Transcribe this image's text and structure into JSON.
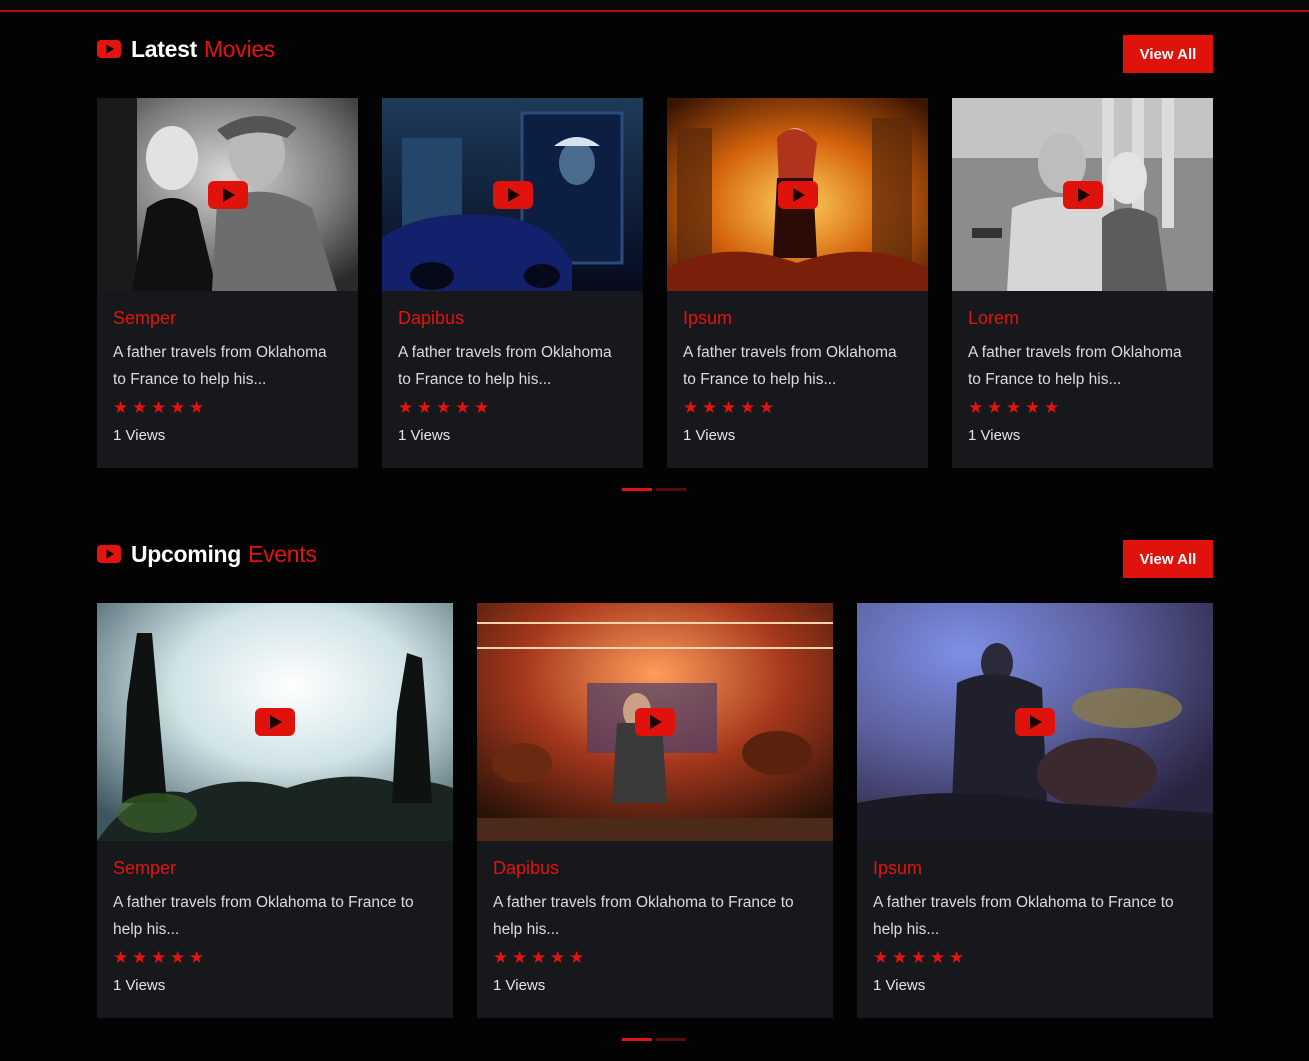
{
  "sections": [
    {
      "title_white": "Latest",
      "title_red": "Movies",
      "view_all_label": "View All",
      "cards": [
        {
          "title": "Semper",
          "description": "A father travels from Oklahoma to France to help his...",
          "rating": 5,
          "views": "1 Views"
        },
        {
          "title": "Dapibus",
          "description": "A father travels from Oklahoma to France to help his...",
          "rating": 5,
          "views": "1 Views"
        },
        {
          "title": "Ipsum",
          "description": "A father travels from Oklahoma to France to help his...",
          "rating": 5,
          "views": "1 Views"
        },
        {
          "title": "Lorem",
          "description": "A father travels from Oklahoma to France to help his...",
          "rating": 5,
          "views": "1 Views"
        }
      ],
      "pager": {
        "pages": 2,
        "active": 0
      }
    },
    {
      "title_white": "Upcoming",
      "title_red": "Events",
      "view_all_label": "View All",
      "cards": [
        {
          "title": "Semper",
          "description": "A father travels from Oklahoma to France to help his...",
          "rating": 5,
          "views": "1 Views"
        },
        {
          "title": "Dapibus",
          "description": "A father travels from Oklahoma to France to help his...",
          "rating": 5,
          "views": "1 Views"
        },
        {
          "title": "Ipsum",
          "description": "A father travels from Oklahoma to France to help his...",
          "rating": 5,
          "views": "1 Views"
        }
      ],
      "pager": {
        "pages": 2,
        "active": 0
      }
    }
  ],
  "icons": {
    "section": "youtube-play-icon",
    "thumb_play": "play-button-icon",
    "rating": "star-icon"
  },
  "colors": {
    "accent": "#e3130f",
    "background": "#030303",
    "card": "#17181c"
  }
}
